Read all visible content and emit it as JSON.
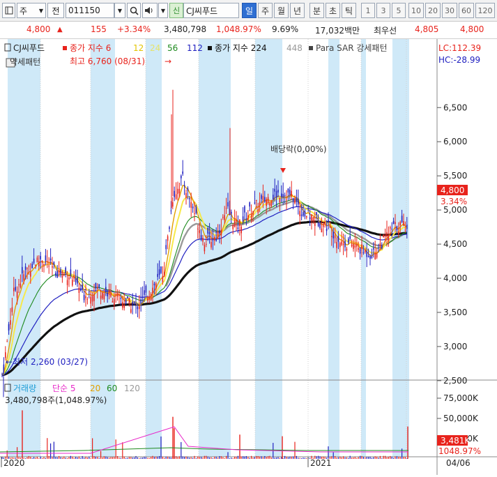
{
  "toolbar": {
    "chart_type_label": "주",
    "prev_label": "전",
    "code_value": "011150",
    "market_tag": "신",
    "stock_name": "CJ씨푸드",
    "periods": [
      "일",
      "주",
      "월",
      "년",
      "분",
      "초",
      "틱"
    ],
    "active_period": "일",
    "intervals": [
      "1",
      "3",
      "5",
      "10",
      "20",
      "30",
      "60",
      "120"
    ]
  },
  "quote": {
    "price": "4,800",
    "change": "155",
    "change_pct": "+3.34%",
    "volume": "3,480,798",
    "volume_ratio": "1,048.97%",
    "turnover": "9.69%",
    "amount": "17,032백만",
    "best_bid_label": "최우선",
    "best_ask": "4,805",
    "best_bid": "4,800",
    "color_up": "#e8231c"
  },
  "price_panel": {
    "legend_name": "CJ씨푸드",
    "legend_ma_label": "종가 지수 6",
    "legend_ma_periods": [
      "12",
      "24",
      "56",
      "112"
    ],
    "legend_ma224": "종가 지수 224",
    "legend_ma448": "448",
    "legend_sar": "Para SAR 강세패턴",
    "pattern_label": "약세패턴",
    "high_note": "최고 6,760 (08/31)",
    "low_note": "←최저 2,260 (03/27)",
    "dividend_note": "배당락(0,00%)",
    "lc": "LC:112.39",
    "hc": "HC:-28.99",
    "axis_ticks": [
      "6,500",
      "6,000",
      "5,500",
      "5,000",
      "4,500",
      "4,000",
      "3,500",
      "3,000",
      "2,500"
    ],
    "current_price_tag": "4,800",
    "current_pct_tag": "3.34%"
  },
  "volume_panel": {
    "title": "거래량",
    "ma_label": "단순 5",
    "ma_periods": [
      "20",
      "60",
      "120"
    ],
    "value_line": "3,480,798주(1,048.97%)",
    "axis_ticks": [
      "75,000K",
      "50,000K",
      "25,000K"
    ],
    "current_vol_tag": "3,481K",
    "current_pct_tag": "1048.97%"
  },
  "x_axis": {
    "labels": [
      "2020",
      "2021"
    ],
    "right_date": "04/06"
  }
}
